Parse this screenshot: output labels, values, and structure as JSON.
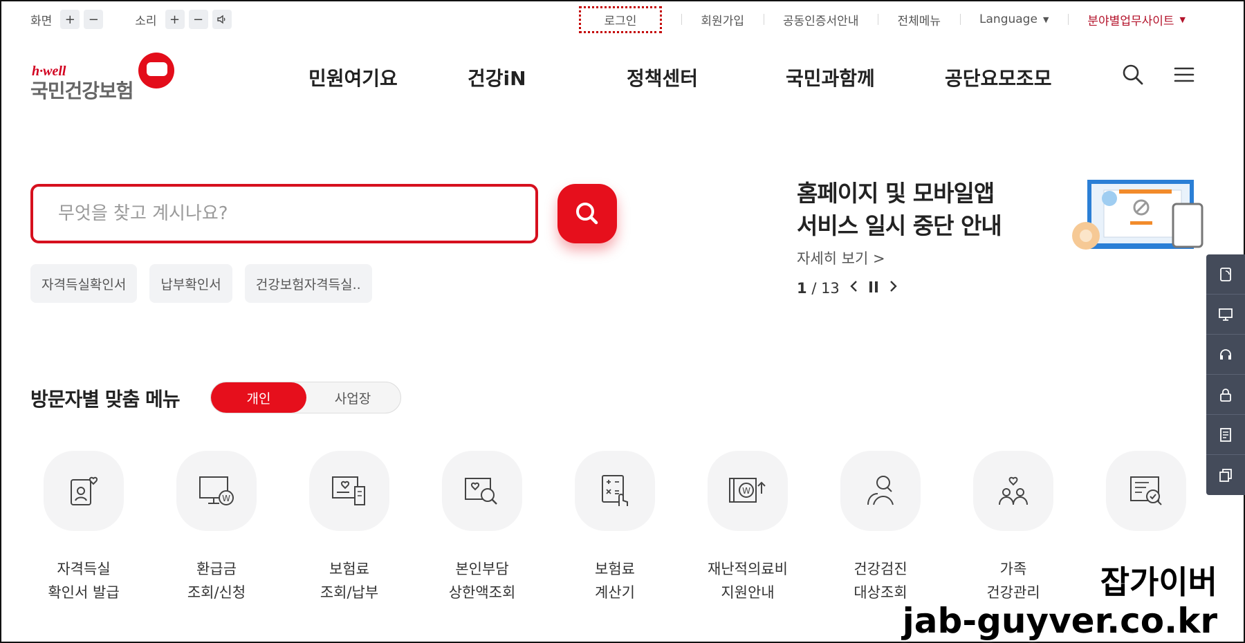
{
  "utility": {
    "screen_label": "화면",
    "sound_label": "소리",
    "plus": "+",
    "minus": "−",
    "speaker_icon": "speaker-icon",
    "login": "로그인",
    "signup": "회원가입",
    "cert": "공동인증서안내",
    "allmenu": "전체메뉴",
    "language": "Language",
    "sites": "분야별업무사이트",
    "sites_color": "#b3122a"
  },
  "logo": {
    "tagline": "h·well",
    "name": "국민건강보험"
  },
  "gnb": {
    "items": [
      "민원여기요",
      "건강iN",
      "정책센터",
      "국민과함께",
      "공단요모조모"
    ]
  },
  "search": {
    "placeholder": "무엇을 찾고 계시나요?",
    "accent": "#e60f1c",
    "chips": [
      "자격득실확인서",
      "납부확인서",
      "건강보험자격득실.."
    ]
  },
  "notice": {
    "title_line1": "홈페이지 및 모바일앱",
    "title_line2": "서비스 일시 중단 안내",
    "more": "자세히 보기 >",
    "current": "1",
    "total": "/ 13"
  },
  "visitor": {
    "title": "방문자별 맞춤 메뉴",
    "tab_personal": "개인",
    "tab_business": "사업장",
    "services": [
      {
        "l1": "자격득실",
        "l2": "확인서 발급",
        "icon": "id-card-heart-icon"
      },
      {
        "l1": "환급금",
        "l2": "조회/신청",
        "icon": "monitor-won-icon"
      },
      {
        "l1": "보험료",
        "l2": "조회/납부",
        "icon": "receipt-heart-icon"
      },
      {
        "l1": "본인부담",
        "l2": "상한액조회",
        "icon": "search-heart-icon"
      },
      {
        "l1": "보험료",
        "l2": "계산기",
        "icon": "calculator-icon"
      },
      {
        "l1": "재난적의료비",
        "l2": "지원안내",
        "icon": "won-support-icon"
      },
      {
        "l1": "건강검진",
        "l2": "대상조회",
        "icon": "person-search-icon"
      },
      {
        "l1": "가족",
        "l2": "건강관리",
        "icon": "family-heart-icon"
      },
      {
        "l1": "",
        "l2": "",
        "icon": "document-check-icon"
      }
    ]
  },
  "watermark": {
    "korean": "잡가이버",
    "url": "jab-guyver.co.kr"
  }
}
